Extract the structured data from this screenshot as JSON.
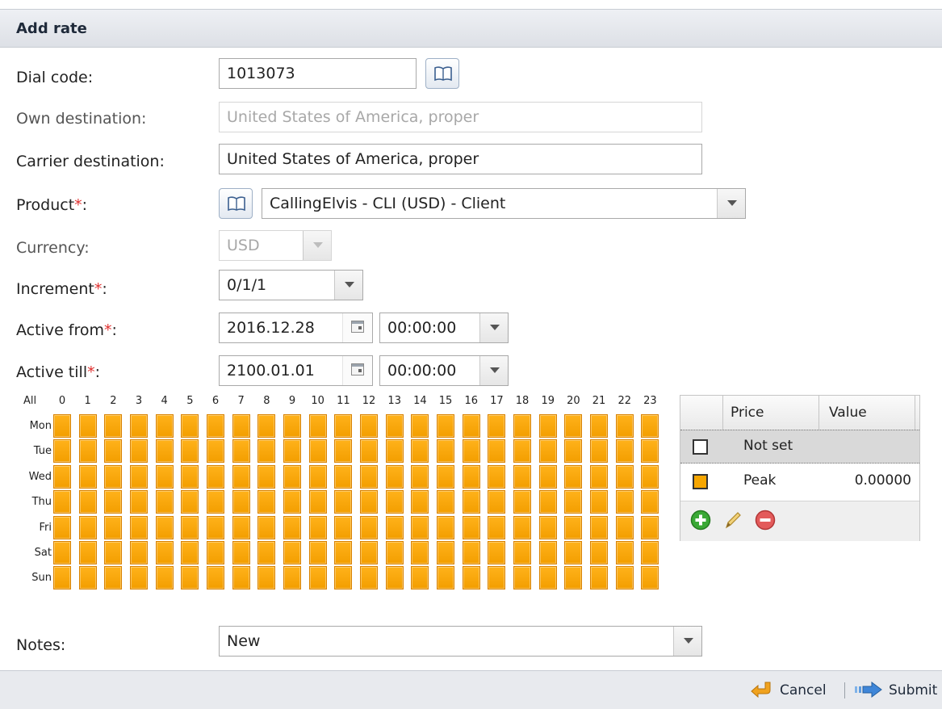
{
  "dialog": {
    "title": "Add rate"
  },
  "form": {
    "dial_code": {
      "label": "Dial code:",
      "value": "1013073"
    },
    "own_destination": {
      "label": "Own destination:",
      "value": "United States of America, proper"
    },
    "carrier_destination": {
      "label": "Carrier destination:",
      "value": "United States of America, proper"
    },
    "product": {
      "label": "Product",
      "required_mark": "*",
      "colon": ":",
      "value": "CallingElvis - CLI (USD) - Client"
    },
    "currency": {
      "label": "Currency:",
      "value": "USD"
    },
    "increment": {
      "label": "Increment",
      "required_mark": "*",
      "colon": ":",
      "value": "0/1/1"
    },
    "active_from": {
      "label": "Active from",
      "required_mark": "*",
      "colon": ":",
      "date": "2016.12.28",
      "time": "00:00:00"
    },
    "active_till": {
      "label": "Active till",
      "required_mark": "*",
      "colon": ":",
      "date": "2100.01.01",
      "time": "00:00:00"
    },
    "notes": {
      "label": "Notes:",
      "value": "New"
    }
  },
  "schedule": {
    "all_label": "All",
    "hours": [
      "0",
      "1",
      "2",
      "3",
      "4",
      "5",
      "6",
      "7",
      "8",
      "9",
      "10",
      "11",
      "12",
      "13",
      "14",
      "15",
      "16",
      "17",
      "18",
      "19",
      "20",
      "21",
      "22",
      "23"
    ],
    "days": [
      "Mon",
      "Tue",
      "Wed",
      "Thu",
      "Fri",
      "Sat",
      "Sun"
    ],
    "cell_color": "#f7a600"
  },
  "price_table": {
    "headers": {
      "price": "Price",
      "value": "Value"
    },
    "rows": [
      {
        "name": "Not set",
        "value": "",
        "color": "#ffffff",
        "selected": true
      },
      {
        "name": "Peak",
        "value": "0.00000",
        "color": "#f7a600",
        "selected": false
      }
    ],
    "tools": [
      "add-icon",
      "edit-pencil-icon",
      "remove-icon"
    ]
  },
  "footer": {
    "cancel_label": "Cancel",
    "submit_label": "Submit"
  }
}
